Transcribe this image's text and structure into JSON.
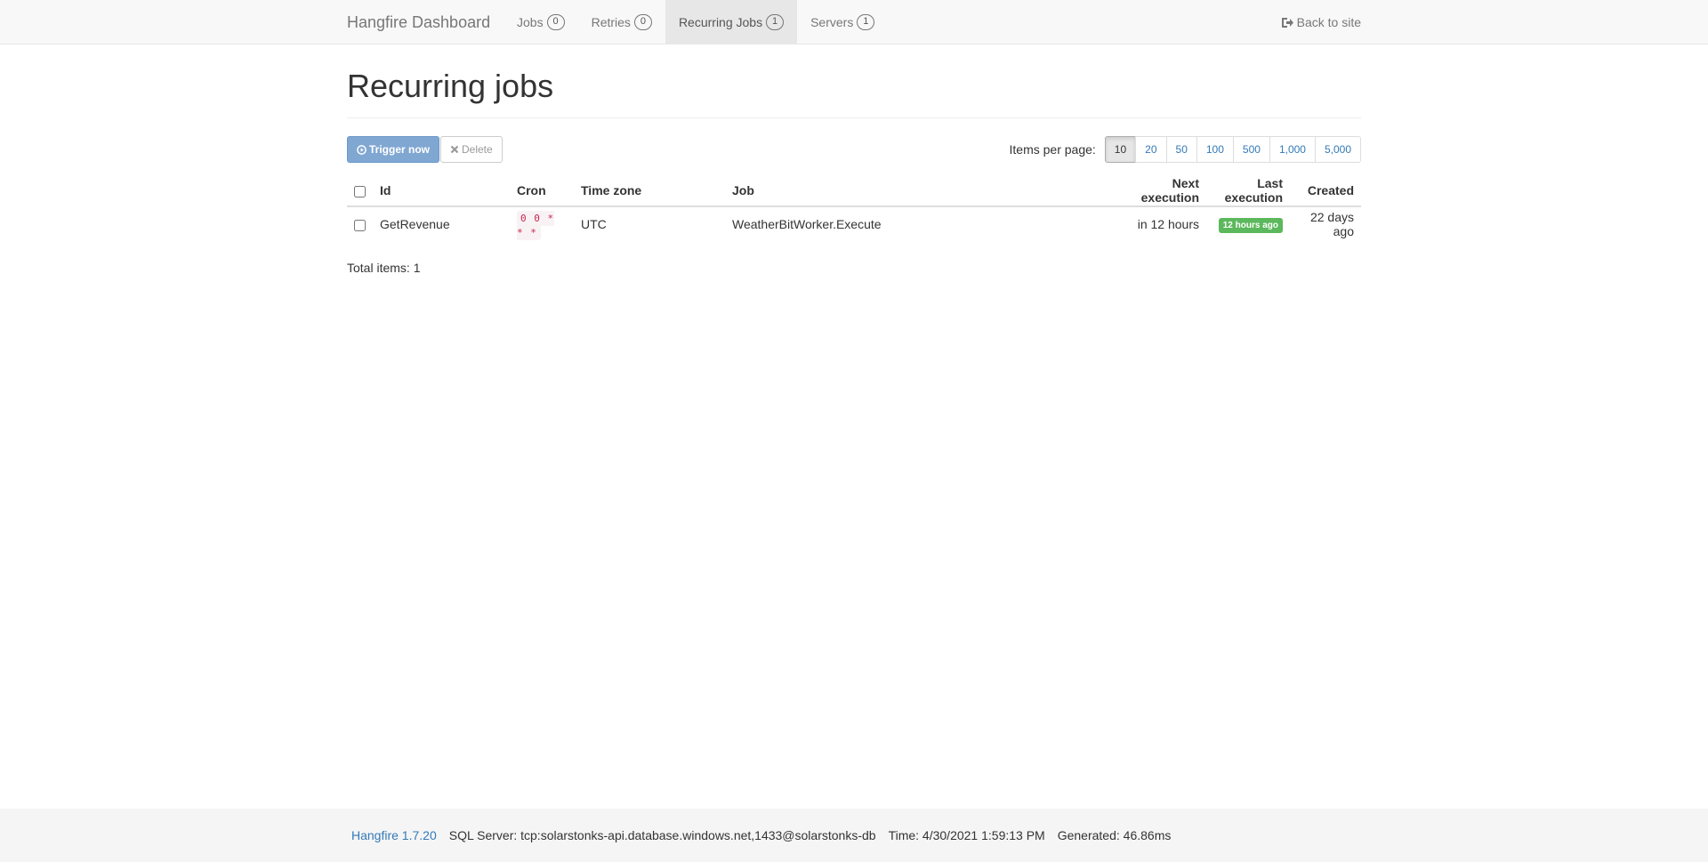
{
  "navbar": {
    "brand": "Hangfire Dashboard",
    "items": [
      {
        "label": "Jobs",
        "count": "0"
      },
      {
        "label": "Retries",
        "count": "0"
      },
      {
        "label": "Recurring Jobs",
        "count": "1"
      },
      {
        "label": "Servers",
        "count": "1"
      }
    ],
    "active_item": "Recurring Jobs",
    "back_label": "Back to site"
  },
  "page": {
    "title": "Recurring jobs"
  },
  "toolbar": {
    "trigger_label": "Trigger now",
    "delete_label": "Delete",
    "items_per_page_label": "Items per page:",
    "page_sizes": [
      "10",
      "20",
      "50",
      "100",
      "500",
      "1,000",
      "5,000"
    ],
    "selected_page_size": "10"
  },
  "table": {
    "headers": {
      "id": "Id",
      "cron": "Cron",
      "timezone": "Time zone",
      "job": "Job",
      "next_execution": "Next execution",
      "last_execution": "Last execution",
      "created": "Created"
    },
    "rows": [
      {
        "id": "GetRevenue",
        "cron": "0 0 * * *",
        "timezone": "UTC",
        "job": "WeatherBitWorker.Execute",
        "next_execution": "in 12 hours",
        "last_execution": "12 hours ago",
        "created": "22 days ago"
      }
    ]
  },
  "summary": {
    "label": "Total items:",
    "count": "1"
  },
  "footer": {
    "version": "Hangfire 1.7.20",
    "storage": "SQL Server: tcp:solarstonks-api.database.windows.net,1433@solarstonks-db",
    "time": "Time: 4/30/2021 1:59:13 PM",
    "generated": "Generated: 46.86ms"
  },
  "icons": {
    "trigger": "play-circle-icon",
    "delete": "close-icon",
    "back": "sign-out-icon"
  },
  "colors": {
    "navbar_bg": "#f8f8f8",
    "primary_button": "#80a7d2",
    "success_label": "#5cb85c",
    "link": "#337ab7",
    "cron_text": "#c7254e"
  }
}
